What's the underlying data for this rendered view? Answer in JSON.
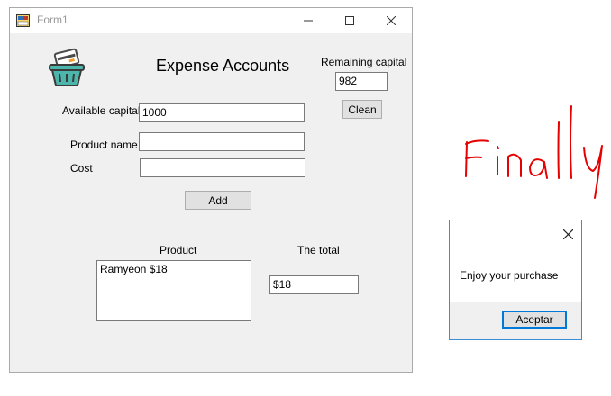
{
  "window": {
    "title": "Form1"
  },
  "form": {
    "heading": "Expense Accounts",
    "remaining_capital_label": "Remaining capital",
    "remaining_capital_value": "982",
    "clean_button": "Clean",
    "available_capital_label": "Available capital",
    "available_capital_value": "1000",
    "product_name_label": "Product name",
    "product_name_value": "",
    "cost_label": "Cost",
    "cost_value": "",
    "add_button": "Add",
    "product_column_label": "Product",
    "total_label": "The total",
    "product_list": [
      "Ramyeon $18"
    ],
    "total_value": "$18"
  },
  "message_box": {
    "text": "Enjoy your purchase",
    "ok_button": "Aceptar"
  },
  "annotation": {
    "handwritten_text": "Finally",
    "color": "#e60000"
  },
  "colors": {
    "accent": "#0078d7",
    "basket": "#4db6ac",
    "card": "#f0a030"
  }
}
